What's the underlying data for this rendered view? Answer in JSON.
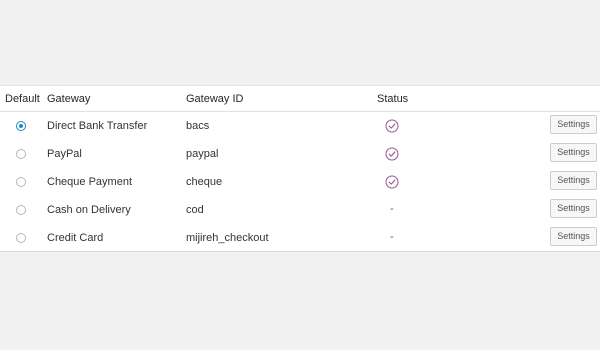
{
  "columns": {
    "default": "Default",
    "gateway": "Gateway",
    "gateway_id": "Gateway ID",
    "status": "Status"
  },
  "rows": [
    {
      "name": "Direct Bank Transfer",
      "id": "bacs",
      "default": true,
      "enabled": true,
      "status_text": "",
      "settings_label": "Settings"
    },
    {
      "name": "PayPal",
      "id": "paypal",
      "default": false,
      "enabled": true,
      "status_text": "",
      "settings_label": "Settings"
    },
    {
      "name": "Cheque Payment",
      "id": "cheque",
      "default": false,
      "enabled": true,
      "status_text": "",
      "settings_label": "Settings"
    },
    {
      "name": "Cash on Delivery",
      "id": "cod",
      "default": false,
      "enabled": false,
      "status_text": "-",
      "settings_label": "Settings"
    },
    {
      "name": "Credit Card",
      "id": "mijireh_checkout",
      "default": false,
      "enabled": false,
      "status_text": "-",
      "settings_label": "Settings"
    }
  ],
  "colors": {
    "radio_selected": "#1e8cbe",
    "status_check": "#96588a"
  },
  "icons": {
    "enabled": "check-circle-icon"
  }
}
